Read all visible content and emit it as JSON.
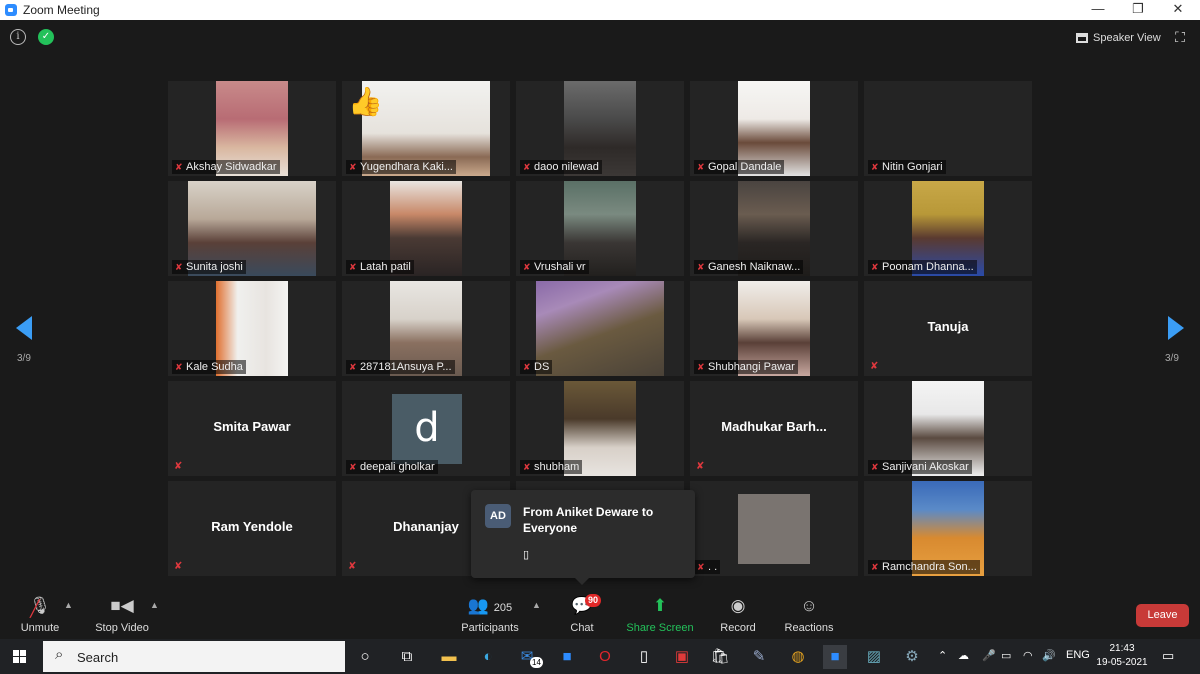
{
  "window": {
    "title": "Zoom Meeting",
    "minimize": "—",
    "restore": "❐",
    "close": "✕"
  },
  "header": {
    "speaker_view_label": "Speaker View"
  },
  "pager": {
    "left_page": "3/9",
    "right_page": "3/9"
  },
  "participants_grid": [
    {
      "name": "Akshay Sidwadkar",
      "video": true
    },
    {
      "name": "Yugendhara Kaki...",
      "video": true
    },
    {
      "name": "daoo nilewad",
      "video": true
    },
    {
      "name": "Gopal Dandale",
      "video": true
    },
    {
      "name": "Nitin Gonjari",
      "video": false
    },
    {
      "name": "Sunita joshi",
      "video": true
    },
    {
      "name": "Latah patil",
      "video": true
    },
    {
      "name": "Vrushali vr",
      "video": true
    },
    {
      "name": "Ganesh Naiknaw...",
      "video": true
    },
    {
      "name": "Poonam Dhanna...",
      "video": true
    },
    {
      "name": "Kale Sudha",
      "video": true
    },
    {
      "name": "287181Ansuya P...",
      "video": true
    },
    {
      "name": "DS",
      "video": true
    },
    {
      "name": "Shubhangi Pawar",
      "video": true
    },
    {
      "name": "Tanuja",
      "video": false
    },
    {
      "name": "Smita Pawar",
      "video": false
    },
    {
      "name": "deepali gholkar",
      "video": false,
      "avatar_letter": "d"
    },
    {
      "name": "shubham",
      "video": true
    },
    {
      "name": "Madhukar  Barh...",
      "video": false
    },
    {
      "name": "Sanjivani Akoskar",
      "video": true
    },
    {
      "name": "Ram Yendole",
      "video": false
    },
    {
      "name": "Dhananjay",
      "video": false
    },
    {
      "name": "",
      "video": false
    },
    {
      "name": ". .",
      "video": true
    },
    {
      "name": "Ramchandra Son...",
      "video": true
    }
  ],
  "chat_popup": {
    "avatar_initials": "AD",
    "title": "From Aniket Deware to Everyone",
    "message": "▯"
  },
  "toolbar": {
    "unmute": "Unmute",
    "stop_video": "Stop Video",
    "participants_count": "205",
    "participants": "Participants",
    "chat": "Chat",
    "chat_badge": "90",
    "share_screen": "Share Screen",
    "record": "Record",
    "reactions": "Reactions",
    "leave": "Leave"
  },
  "taskbar": {
    "search_placeholder": "Search",
    "mail_badge": "14",
    "language": "ENG",
    "time": "21:43",
    "date": "19-05-2021"
  },
  "colors": {
    "accent_blue": "#3b9df5",
    "share_green": "#23c15a",
    "leave_red": "#c83a38",
    "badge_red": "#e02828"
  }
}
